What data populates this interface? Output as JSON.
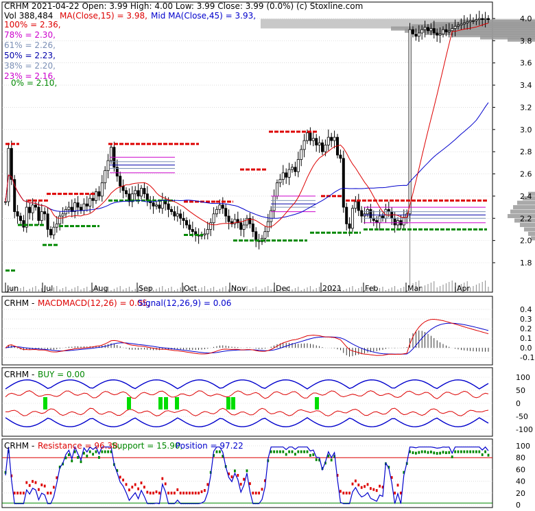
{
  "colors": {
    "frame": "#000000",
    "grid": "#c8c8c8",
    "up_candle": "#000000",
    "red": "#dd0000",
    "blue": "#0000cc",
    "green": "#008800",
    "bright_green": "#00dd00",
    "magenta": "#cc00cc",
    "gray_profile": "#9a9a9a",
    "fib_levels": [
      "#dd0000",
      "#cc00cc",
      "#7b8fb5",
      "#0000aa",
      "#7b8fb5",
      "#cc00cc",
      "#008800"
    ]
  },
  "header": {
    "line1": "CRHM  2021-04-22 Open: 3.99  High: 4.00  Low: 3.99  Close: 3.99 (0.0%)  (c) Stoxline.com",
    "vol": "Vol 388,484",
    "ma15": "MA(Close,15) = 3.98,",
    "ma45": "Mid MA(Close,45) = 3.93,"
  },
  "fib": [
    {
      "label": "100% = 2.36,",
      "color": "#dd0000"
    },
    {
      "label": "78% = 2.30,",
      "color": "#cc00cc"
    },
    {
      "label": "61% = 2.26,",
      "color": "#7b8fb5"
    },
    {
      "label": "50% = 2.23,",
      "color": "#0000aa"
    },
    {
      "label": "38% = 2.20,",
      "color": "#7b8fb5"
    },
    {
      "label": "23% = 2.16,",
      "color": "#cc00cc"
    },
    {
      "label": "0% = 2.10,",
      "color": "#008800"
    }
  ],
  "macd_panel": {
    "title_name": "CRHM",
    "title_main": "MACDMACD(12,26) = 0.05,",
    "title_signal": "Signal(12,26,9) = 0.06"
  },
  "buy_panel": {
    "title_name": "CRHM",
    "title_main": "BUY = 0.00"
  },
  "sr_panel": {
    "title_name": "CRHM",
    "title_res": "Resistance = 96.38,",
    "title_sup": "Support = 15.90,",
    "title_pos": "Position = 97.22"
  },
  "chart_data": [
    {
      "type": "candlestick",
      "name": "price",
      "x_labels": [
        "Jun",
        "Jul",
        "Aug",
        "Sep",
        "Oct",
        "Nov",
        "Dec",
        "2021",
        "Feb",
        "Mar",
        "Apr"
      ],
      "y_ticks": [
        "4.0",
        "3.8",
        "3.6",
        "3.4",
        "3.2",
        "3.0",
        "2.8",
        "2.6",
        "2.4",
        "2.2",
        "2.0",
        "1.8"
      ],
      "ylim": [
        1.7,
        4.03
      ],
      "close": [
        2.35,
        2.83,
        2.55,
        2.26,
        2.22,
        2.18,
        2.12,
        2.3,
        2.25,
        2.32,
        2.3,
        2.18,
        2.26,
        2.24,
        2.1,
        2.05,
        2.12,
        2.15,
        2.22,
        2.24,
        2.28,
        2.3,
        2.26,
        2.34,
        2.3,
        2.27,
        2.33,
        2.31,
        2.38,
        2.36,
        2.44,
        2.4,
        2.52,
        2.63,
        2.72,
        2.84,
        2.66,
        2.58,
        2.49,
        2.45,
        2.42,
        2.35,
        2.42,
        2.45,
        2.4,
        2.47,
        2.42,
        2.36,
        2.34,
        2.31,
        2.32,
        2.29,
        2.36,
        2.33,
        2.28,
        2.26,
        2.22,
        2.24,
        2.2,
        2.18,
        2.14,
        2.1,
        2.08,
        2.05,
        2.04,
        2.05,
        2.06,
        2.1,
        2.16,
        2.24,
        2.28,
        2.32,
        2.29,
        2.22,
        2.17,
        2.15,
        2.19,
        2.16,
        2.1,
        2.14,
        2.2,
        2.15,
        2.08,
        2.0,
        1.99,
        2.02,
        2.08,
        2.17,
        2.27,
        2.4,
        2.52,
        2.55,
        2.61,
        2.57,
        2.64,
        2.66,
        2.62,
        2.73,
        2.82,
        2.9,
        2.97,
        2.9,
        2.92,
        2.86,
        2.88,
        2.8,
        2.86,
        2.93,
        2.9,
        2.93,
        2.77,
        2.74,
        2.3,
        2.15,
        2.11,
        2.29,
        2.35,
        2.27,
        2.22,
        2.24,
        2.28,
        2.2,
        2.18,
        2.16,
        2.22,
        2.2,
        2.28,
        2.26,
        2.2,
        2.14,
        2.18,
        2.14,
        2.21,
        2.24,
        3.9,
        3.86,
        3.84,
        3.87,
        3.9,
        3.92,
        3.89,
        3.91,
        3.87,
        3.85,
        3.86,
        3.9,
        3.88,
        3.89,
        3.91,
        3.93,
        3.94,
        3.95,
        3.96,
        3.97,
        3.98,
        3.98,
        3.99,
        4.0,
        3.99,
        4.0,
        3.99
      ],
      "volume_profile_note": "horizontal volume-at-price bars drawn on right side"
    },
    {
      "type": "line",
      "name": "macd",
      "y_ticks": [
        "0.4",
        "0.3",
        "0.2",
        "0.1",
        "0.0",
        "-0.1"
      ],
      "ylim": [
        -0.15,
        0.47
      ],
      "series": [
        {
          "name": "MACD(12,26)"
        },
        {
          "name": "Signal(12,26,9)"
        }
      ],
      "values_last": {
        "macd": 0.05,
        "signal": 0.06
      }
    },
    {
      "type": "line",
      "name": "buy",
      "y_ticks": [
        "100",
        "50",
        "0",
        "-50",
        "-100"
      ],
      "ylim": [
        -115,
        120
      ],
      "values_last": {
        "buy": 0.0
      }
    },
    {
      "type": "line",
      "name": "support_resistance",
      "y_ticks": [
        "100",
        "80",
        "60",
        "40",
        "20",
        "0"
      ],
      "ylim": [
        0,
        105
      ],
      "values_last": {
        "resistance": 96.38,
        "support": 15.9,
        "position": 97.22
      }
    }
  ]
}
